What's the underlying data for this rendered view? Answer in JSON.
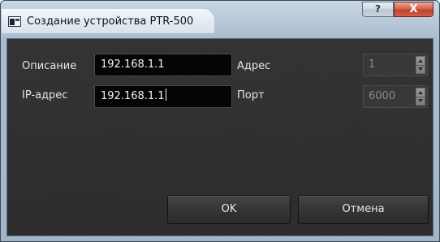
{
  "window": {
    "title": "Создание устройства PTR-500",
    "help_label": "?",
    "close_label": "X"
  },
  "form": {
    "description_label": "Описание",
    "description_value": "192.168.1.1",
    "ip_label": "IP-адрес",
    "ip_value": "192.168.1.1",
    "address_label": "Адрес",
    "address_value": "1",
    "port_label": "Порт",
    "port_value": "6000"
  },
  "buttons": {
    "ok_label": "OK",
    "cancel_label": "Отмена"
  },
  "icons": {
    "app": "window-app-icon",
    "help": "help-icon",
    "close": "close-icon",
    "spin_up": "chevron-up-icon",
    "spin_down": "chevron-down-icon"
  },
  "colors": {
    "titlebar": "#bccbdb",
    "close_button": "#c8503a",
    "client_background": "#2f2f2f",
    "input_background": "#050505",
    "text": "#e6e6e6"
  }
}
